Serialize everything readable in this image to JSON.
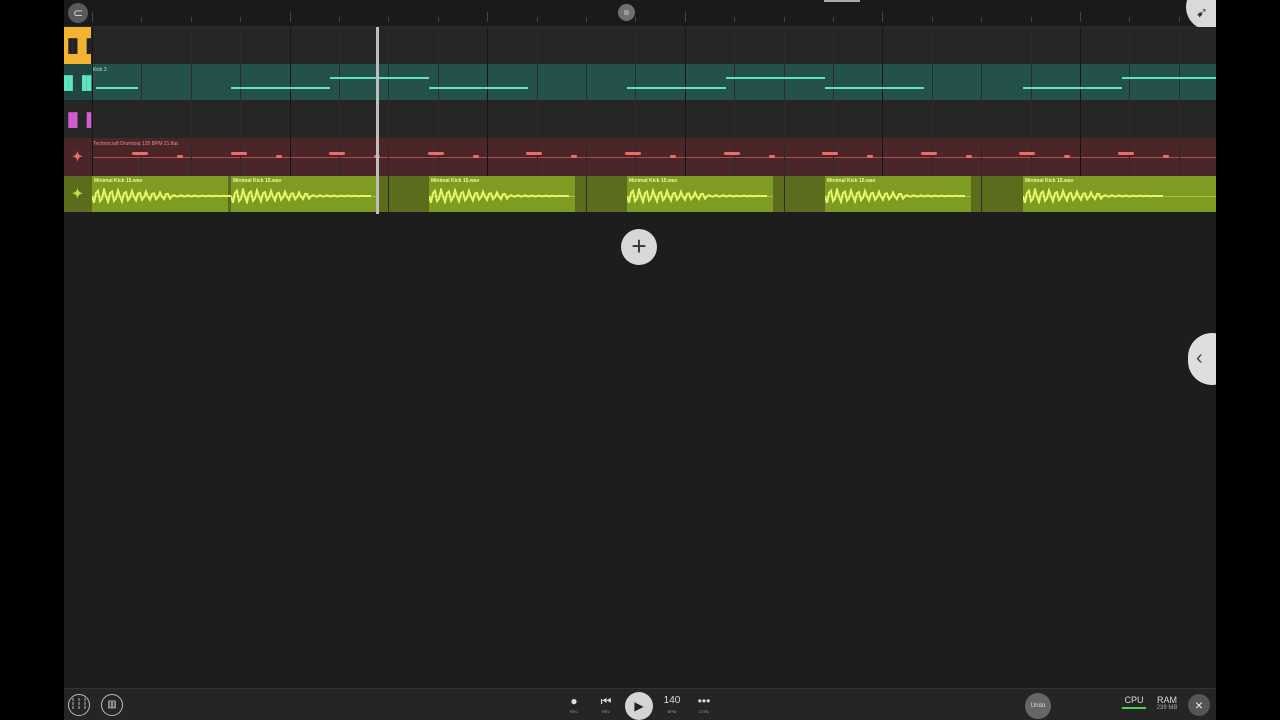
{
  "ruler": {
    "left_icon": "magnet-icon",
    "corner_icon": "cursor-icon"
  },
  "tracks": [
    {
      "icon": "drum-machine-icon",
      "glyph": "▐▌▐",
      "color": "#f2b330"
    },
    {
      "icon": "synth-icon",
      "glyph": "▐▌▐▌",
      "color": "#5ee3c4",
      "clip_label": "Kick 3"
    },
    {
      "icon": "keys-icon",
      "glyph": "▐▌▐",
      "color": "#d45bd3"
    },
    {
      "icon": "audio-loop-icon",
      "glyph": "✦",
      "color": "#ef6b6b",
      "clip_label": "Technocraft Drumloop125 BPM 21.flac"
    },
    {
      "icon": "audio-sample-icon",
      "glyph": "✦",
      "color": "#c9e046",
      "clip_label": "Minimal Kick 15.wav"
    }
  ],
  "kick_clips": [
    "Minimal Kick 15.wav",
    "Minimal Kick 15.wav",
    "Minimal Kick 15.wav",
    "Minimal Kick 15.wav",
    "Minimal Kick 15.wav",
    "Minimal Kick 15.wav"
  ],
  "add_track": {
    "symbol": "+"
  },
  "side_tab": {
    "symbol": "‹"
  },
  "transport": {
    "mixer_icon": "mixer-icon",
    "browser_icon": "pattern-browser-icon",
    "rec_label": "REC",
    "rev_label": "REV",
    "bpm_value": "140",
    "bpm_label": "BPM",
    "ctrl_label": "CTRL",
    "undo_label": "Undo",
    "cpu_label": "CPU",
    "ram_label": "RAM",
    "ram_value": "239 MB",
    "close_symbol": "×"
  }
}
